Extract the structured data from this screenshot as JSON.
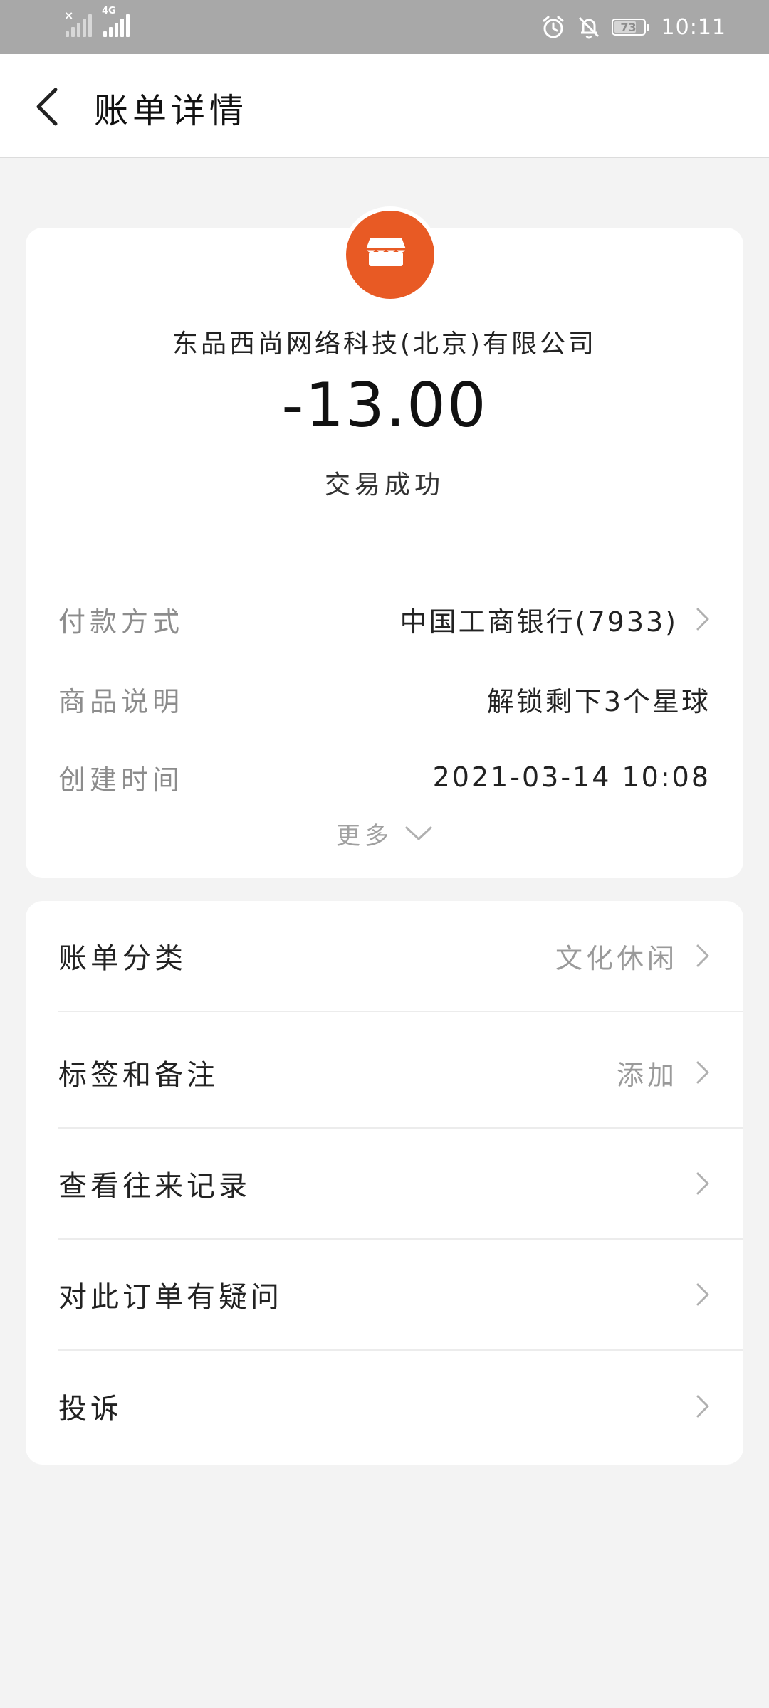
{
  "status_bar": {
    "network": "4G",
    "battery": "73",
    "time": "10:11"
  },
  "header": {
    "title": "账单详情"
  },
  "summary": {
    "merchant": "东品西尚网络科技(北京)有限公司",
    "amount": "-13.00",
    "status": "交易成功",
    "logo_color": "#e85a24"
  },
  "details": [
    {
      "label": "付款方式",
      "value": "中国工商银行(7933)"
    },
    {
      "label": "商品说明",
      "value": "解锁剩下3个星球"
    },
    {
      "label": "创建时间",
      "value": "2021-03-14 10:08"
    }
  ],
  "more_label": "更多",
  "menu": [
    {
      "label": "账单分类",
      "value": "文化休闲"
    },
    {
      "label": "标签和备注",
      "value": "添加"
    },
    {
      "label": "查看往来记录",
      "value": ""
    },
    {
      "label": "对此订单有疑问",
      "value": ""
    },
    {
      "label": "投诉",
      "value": ""
    }
  ]
}
